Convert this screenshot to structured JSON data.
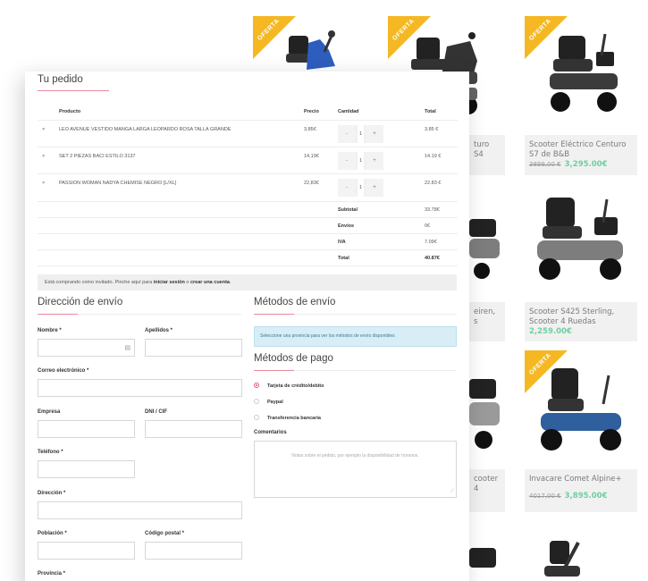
{
  "background_products": [
    {
      "name": "",
      "old_price": "",
      "price": "",
      "offer": true
    },
    {
      "name": "",
      "old_price": "",
      "price": "",
      "offer": true
    },
    {
      "name": "",
      "old_price": "",
      "price": "",
      "offer": true
    },
    {
      "name": "turo S4",
      "old_price": "",
      "price": "",
      "offer": false
    },
    {
      "name": "Scooter Eléctrico Centuro S7 de B&B",
      "old_price": "3899,00 €",
      "price": "3,295.00€",
      "offer": false
    },
    {
      "name": "eiren,",
      "name2": "s",
      "old_price": "",
      "price": "",
      "offer": false
    },
    {
      "name": "Scooter S425 Sterling, Scooter 4 Ruedas",
      "old_price": "",
      "price": "2,259.00€",
      "offer": false
    },
    {
      "name": "cooter 4",
      "old_price": "",
      "price": "",
      "offer": false
    },
    {
      "name": "Invacare Comet Alpine+",
      "old_price": "4017,00 €",
      "price": "3,895.00€",
      "offer": true
    }
  ],
  "offer_label": "OFERTA",
  "order": {
    "title": "Tu pedido",
    "columns": {
      "product": "Producto",
      "price": "Precio",
      "qty": "Cantidad",
      "total": "Total"
    },
    "items": [
      {
        "remove": "×",
        "name": "LEO AVENUE VESTIDO MANGA LARGA LEOPARDO ROSA TALLA GRANDE",
        "price": "3,85€",
        "minus": "-",
        "qty": "1",
        "plus": "+",
        "total": "3.85 €"
      },
      {
        "remove": "×",
        "name": "SET 2 PIEZAS BACI ESTILO 3137",
        "price": "14,19€",
        "minus": "-",
        "qty": "1",
        "plus": "+",
        "total": "14.19 €"
      },
      {
        "remove": "×",
        "name": "PASSION WOMAN NADYA CHEMISE NEGRO [L/XL]",
        "price": "22,83€",
        "minus": "-",
        "qty": "1",
        "plus": "+",
        "total": "22.83 €"
      }
    ],
    "summary": [
      {
        "label": "Subtotal",
        "value": "33.78€"
      },
      {
        "label": "Envíos",
        "value": "0€"
      },
      {
        "label": "IVA",
        "value": "7.09€"
      },
      {
        "label": "Total",
        "value": "40.87€"
      }
    ]
  },
  "notice": {
    "text1": "Está comprando como invitado. Pinche aquí para ",
    "login": "iniciar sesión",
    "text2": " o ",
    "create": "crear una cuenta",
    "text3": "."
  },
  "shipping_address": {
    "title": "Dirección de envío",
    "nombre": "Nombre *",
    "apellidos": "Apellidos *",
    "email": "Correo electrónico *",
    "empresa": "Empresa",
    "dni": "DNI / CIF",
    "telefono": "Teléfono *",
    "direccion": "Dirección *",
    "poblacion": "Población *",
    "cp": "Código postal *",
    "provincia": "Provincia *"
  },
  "shipping_methods": {
    "title": "Métodos de envío",
    "info": "Seleccione una provincia para ver los métodos de envío disponibles"
  },
  "payment_methods": {
    "title": "Métodos de pago",
    "options": [
      {
        "label": "Tarjeta de crédito/debito",
        "selected": true
      },
      {
        "label": "Paypal",
        "selected": false
      },
      {
        "label": "Transferencia bancaria",
        "selected": false
      }
    ],
    "comments_label": "Comentarios",
    "comments_placeholder": "Notas sobre el pedido, por ejemplo la disponibilidad de horarios."
  },
  "colors": {
    "accent": "#e98a9d",
    "price_green": "#6fcfa1",
    "offer": "#f5b823",
    "info_bg": "#d8edf6"
  }
}
